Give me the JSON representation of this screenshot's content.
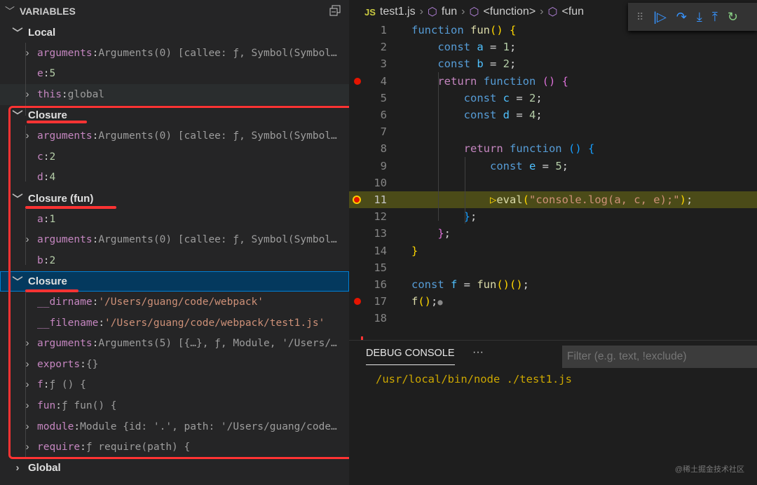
{
  "variables": {
    "title": "VARIABLES",
    "rows": [
      {
        "type": "scope",
        "label": "Local",
        "expanded": true
      },
      {
        "type": "var",
        "name": "arguments",
        "value": "Arguments(0) [callee: ƒ, Symbol(Symbol…",
        "expandable": true
      },
      {
        "type": "var",
        "name": "e",
        "value": "5",
        "vclass": "num"
      },
      {
        "type": "var",
        "name": "this",
        "value": "global",
        "expandable": true,
        "hover": true
      },
      {
        "type": "scope",
        "label": "Closure",
        "expanded": true
      },
      {
        "type": "var",
        "name": "arguments",
        "value": "Arguments(0) [callee: ƒ, Symbol(Symbol…",
        "expandable": true
      },
      {
        "type": "var",
        "name": "c",
        "value": "2",
        "vclass": "num"
      },
      {
        "type": "var",
        "name": "d",
        "value": "4",
        "vclass": "num"
      },
      {
        "type": "scope",
        "label": "Closure (fun)",
        "expanded": true
      },
      {
        "type": "var",
        "name": "a",
        "value": "1",
        "vclass": "num"
      },
      {
        "type": "var",
        "name": "arguments",
        "value": "Arguments(0) [callee: ƒ, Symbol(Symbol…",
        "expandable": true
      },
      {
        "type": "var",
        "name": "b",
        "value": "2",
        "vclass": "num"
      },
      {
        "type": "scope",
        "label": "Closure",
        "expanded": true,
        "selected": true
      },
      {
        "type": "var",
        "name": "__dirname",
        "value": "'/Users/guang/code/webpack'",
        "vclass": "str"
      },
      {
        "type": "var",
        "name": "__filename",
        "value": "'/Users/guang/code/webpack/test1.js'",
        "vclass": "str"
      },
      {
        "type": "var",
        "name": "arguments",
        "value": "Arguments(5) [{…}, ƒ, Module, '/Users/…",
        "expandable": true
      },
      {
        "type": "var",
        "name": "exports",
        "value": "{}",
        "expandable": true
      },
      {
        "type": "var",
        "name": "f",
        "value": "ƒ () {",
        "expandable": true
      },
      {
        "type": "var",
        "name": "fun",
        "value": "ƒ fun() {",
        "expandable": true
      },
      {
        "type": "var",
        "name": "module",
        "value": "Module {id: '.', path: '/Users/guang/code…",
        "expandable": true
      },
      {
        "type": "var",
        "name": "require",
        "value": "ƒ require(path) {",
        "expandable": true
      },
      {
        "type": "scope",
        "label": "Global",
        "expanded": false
      }
    ]
  },
  "breadcrumb": {
    "file": "test1.js",
    "file_icon": "JS",
    "items": [
      "fun",
      "<function>",
      "<fun"
    ]
  },
  "debug_toolbar": [
    "continue",
    "step-over",
    "step-into",
    "step-out",
    "restart"
  ],
  "code": {
    "current_line": 11,
    "breakpoints": [
      4,
      17
    ],
    "lines": [
      [
        [
          "function ",
          "k"
        ],
        [
          "fun",
          "f"
        ],
        [
          "() ",
          "y"
        ],
        [
          "{",
          "y"
        ]
      ],
      [
        [
          "    const ",
          "k"
        ],
        [
          "a",
          "v"
        ],
        [
          " = ",
          "p"
        ],
        [
          "1",
          "n"
        ],
        [
          ";",
          "p"
        ]
      ],
      [
        [
          "    const ",
          "k"
        ],
        [
          "b",
          "v"
        ],
        [
          " = ",
          "p"
        ],
        [
          "2",
          "n"
        ],
        [
          ";",
          "p"
        ]
      ],
      [
        [
          "    return ",
          "kc"
        ],
        [
          "function ",
          "k"
        ],
        [
          "() ",
          "m"
        ],
        [
          "{",
          "m"
        ]
      ],
      [
        [
          "        const ",
          "k"
        ],
        [
          "c",
          "v"
        ],
        [
          " = ",
          "p"
        ],
        [
          "2",
          "n"
        ],
        [
          ";",
          "p"
        ]
      ],
      [
        [
          "        const ",
          "k"
        ],
        [
          "d",
          "v"
        ],
        [
          " = ",
          "p"
        ],
        [
          "4",
          "n"
        ],
        [
          ";",
          "p"
        ]
      ],
      [],
      [
        [
          "        return ",
          "kc"
        ],
        [
          "function ",
          "k"
        ],
        [
          "() ",
          "b"
        ],
        [
          "{",
          "b"
        ]
      ],
      [
        [
          "            const ",
          "k"
        ],
        [
          "e",
          "v"
        ],
        [
          " = ",
          "p"
        ],
        [
          "5",
          "n"
        ],
        [
          ";",
          "p"
        ]
      ],
      [],
      [
        [
          "            ",
          "p"
        ],
        [
          "▷",
          "y"
        ],
        [
          "eval",
          "f"
        ],
        [
          "(",
          "y"
        ],
        [
          "\"console.log(a, c, e);\"",
          "s"
        ],
        [
          ")",
          "y"
        ],
        [
          ";",
          "p"
        ]
      ],
      [
        [
          "        }",
          "b"
        ],
        [
          ";",
          "p"
        ]
      ],
      [
        [
          "    }",
          "m"
        ],
        [
          ";",
          "p"
        ]
      ],
      [
        [
          "}",
          "y"
        ]
      ],
      [],
      [
        [
          "const ",
          "k"
        ],
        [
          "f",
          "v"
        ],
        [
          " = ",
          "p"
        ],
        [
          "fun",
          "f"
        ],
        [
          "()()",
          "y"
        ],
        [
          ";",
          "p"
        ]
      ],
      [
        [
          "f",
          "f"
        ],
        [
          "()",
          "y"
        ],
        [
          ";",
          "p"
        ],
        [
          "●",
          "p"
        ]
      ],
      []
    ]
  },
  "panel": {
    "tab": "DEBUG CONSOLE",
    "more": "···",
    "filter_placeholder": "Filter (e.g. text, !exclude)",
    "output": "/usr/local/bin/node ./test1.js"
  },
  "watermark": "@稀土掘金技术社区"
}
